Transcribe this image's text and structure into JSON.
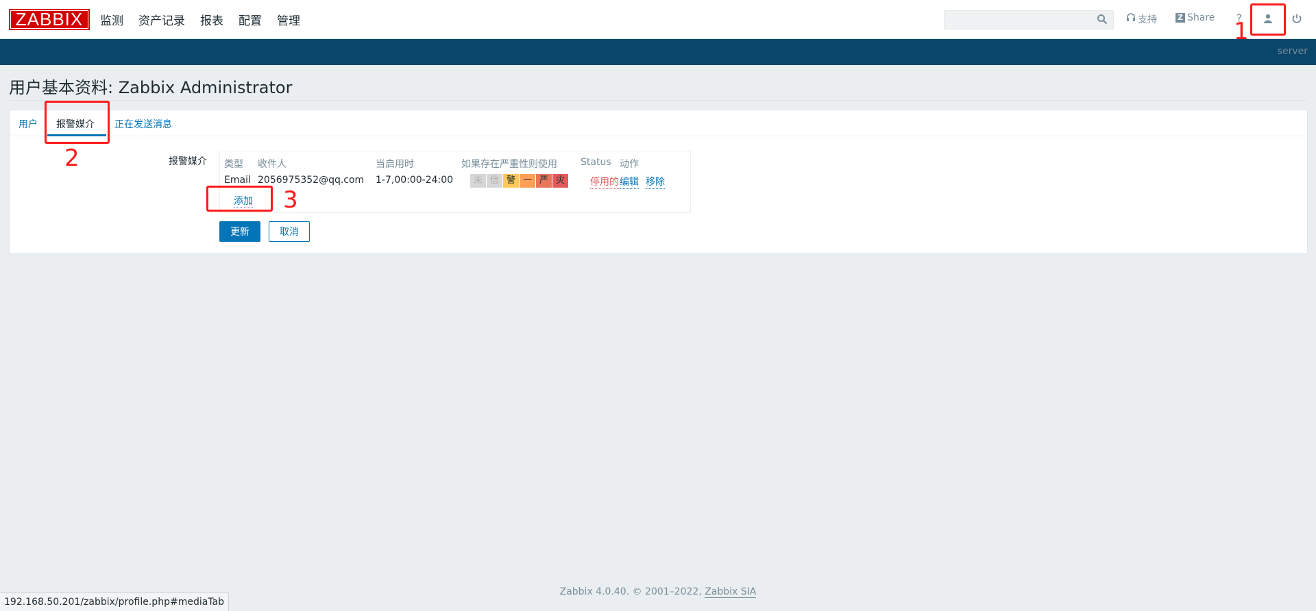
{
  "header": {
    "logo": "ZABBIX",
    "nav": [
      "监测",
      "资产记录",
      "报表",
      "配置",
      "管理"
    ],
    "search": {
      "value": "",
      "placeholder": ""
    },
    "support_label": "支持",
    "share_label": "Share",
    "help_label": "?"
  },
  "subbar": {
    "server": "server"
  },
  "page": {
    "title": "用户基本资料: Zabbix Administrator"
  },
  "tabs": [
    {
      "label": "用户"
    },
    {
      "label": "报警媒介"
    },
    {
      "label": "正在发送消息"
    }
  ],
  "media": {
    "field_label": "报警媒介",
    "columns": [
      "类型",
      "收件人",
      "当启用时",
      "如果存在严重性则使用",
      "Status",
      "动作"
    ],
    "rows": [
      {
        "type": "Email",
        "recipient": "2056975352@qq.com",
        "when_active": "1-7,00:00-24:00",
        "severities": [
          {
            "label": "未",
            "bg": "#d6d6d6",
            "fg": "#aeaeae"
          },
          {
            "label": "信",
            "bg": "#d6d6d6",
            "fg": "#aeaeae"
          },
          {
            "label": "警",
            "bg": "#ffc859",
            "fg": "#1f2c33"
          },
          {
            "label": "一",
            "bg": "#ffa059",
            "fg": "#1f2c33"
          },
          {
            "label": "严",
            "bg": "#e97659",
            "fg": "#1f2c33"
          },
          {
            "label": "灾",
            "bg": "#e45959",
            "fg": "#1f2c33"
          }
        ],
        "status": "停用的",
        "edit": "编辑",
        "remove": "移除"
      }
    ],
    "add_label": "添加"
  },
  "buttons": {
    "update": "更新",
    "cancel": "取消"
  },
  "annotations": [
    "1",
    "2",
    "3"
  ],
  "footer": {
    "text": "Zabbix 4.0.40. © 2001–2022,",
    "link": "Zabbix SIA"
  },
  "statusbar": {
    "url": "192.168.50.201/zabbix/profile.php#mediaTab"
  },
  "colors": {
    "brand": "#d40000",
    "accent": "#0275b8",
    "subbar": "#0a466a",
    "annotation": "#ff1a1a"
  }
}
